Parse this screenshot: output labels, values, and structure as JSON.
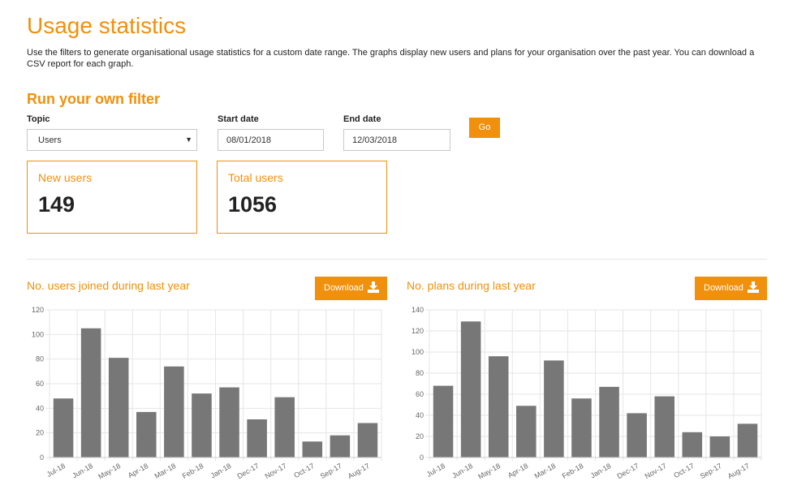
{
  "page": {
    "title": "Usage statistics",
    "intro": "Use the filters to generate organisational usage statistics for a custom date range. The graphs display new users and plans for your organisation over the past year. You can download a CSV report for each graph."
  },
  "filter": {
    "heading": "Run your own filter",
    "topic_label": "Topic",
    "topic_value": "Users",
    "start_label": "Start date",
    "start_value": "08/01/2018",
    "end_label": "End date",
    "end_value": "12/03/2018",
    "go_label": "Go"
  },
  "stats": {
    "new_users_label": "New users",
    "new_users_value": "149",
    "total_users_label": "Total users",
    "total_users_value": "1056"
  },
  "charts": {
    "download_label": "Download",
    "users_title": "No. users joined during last year",
    "plans_title": "No. plans during last year",
    "bar_color": "#777777",
    "accent": "#f0900c"
  },
  "chart_data": [
    {
      "type": "bar",
      "title": "No. users joined during last year",
      "categories": [
        "Jul-18",
        "Jun-18",
        "May-18",
        "Apr-18",
        "Mar-18",
        "Feb-18",
        "Jan-18",
        "Dec-17",
        "Nov-17",
        "Oct-17",
        "Sep-17",
        "Aug-17"
      ],
      "values": [
        48,
        105,
        81,
        37,
        74,
        52,
        57,
        31,
        49,
        13,
        18,
        28
      ],
      "ylim": [
        0,
        120
      ],
      "yticks": [
        0,
        20,
        40,
        60,
        80,
        100,
        120
      ],
      "grid": true
    },
    {
      "type": "bar",
      "title": "No. plans during last year",
      "categories": [
        "Jul-18",
        "Jun-18",
        "May-18",
        "Apr-18",
        "Mar-18",
        "Feb-18",
        "Jan-18",
        "Dec-17",
        "Nov-17",
        "Oct-17",
        "Sep-17",
        "Aug-17"
      ],
      "values": [
        68,
        129,
        96,
        49,
        92,
        56,
        67,
        42,
        58,
        24,
        20,
        32
      ],
      "ylim": [
        0,
        140
      ],
      "yticks": [
        0,
        20,
        40,
        60,
        80,
        100,
        120,
        140
      ],
      "grid": true
    }
  ]
}
